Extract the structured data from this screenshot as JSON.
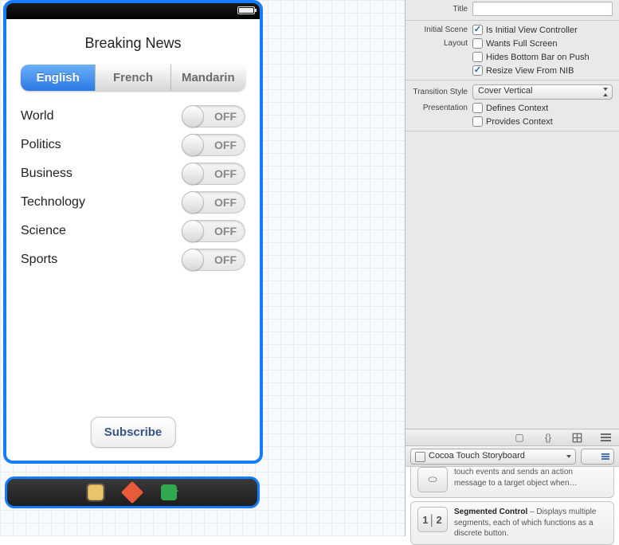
{
  "app": {
    "title": "Breaking News",
    "segments": [
      "English",
      "French",
      "Mandarin"
    ],
    "active_segment": 0,
    "categories": [
      "World",
      "Politics",
      "Business",
      "Technology",
      "Science",
      "Sports"
    ],
    "switch_off_label": "OFF",
    "subscribe_label": "Subscribe"
  },
  "inspector": {
    "title_label": "Title",
    "title_value": "",
    "initial_scene_label": "Initial Scene",
    "is_initial_vc": "Is Initial View Controller",
    "layout_label": "Layout",
    "wants_full_screen": "Wants Full Screen",
    "hides_bottom_bar": "Hides Bottom Bar on Push",
    "resize_from_nib": "Resize View From NIB",
    "transition_label": "Transition Style",
    "transition_value": "Cover Vertical",
    "presentation_label": "Presentation",
    "defines_context": "Defines Context",
    "provides_context": "Provides Context"
  },
  "library": {
    "filter": "Cocoa Touch Storyboard",
    "item1_tail": "touch events and sends an action message to a target object when…",
    "item2_title": "Segmented Control",
    "item2_desc": " – Displays multiple segments, each of which functions as a discrete button."
  }
}
